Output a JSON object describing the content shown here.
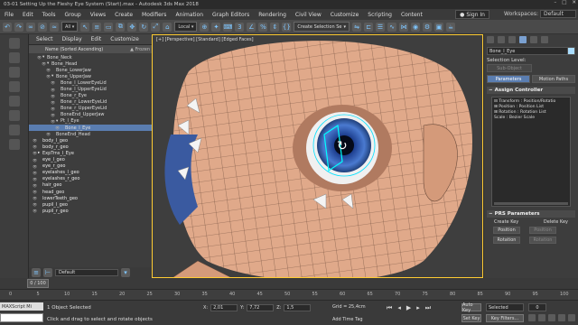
{
  "titlebar": {
    "title": "03-01 Setting Up the Fleshy Eye System (Start).max - Autodesk 3ds Max 2018",
    "min": "–",
    "max": "□",
    "close": "✕"
  },
  "menu": {
    "items": [
      "File",
      "Edit",
      "Tools",
      "Group",
      "Views",
      "Create",
      "Modifiers",
      "Animation",
      "Graph Editors",
      "Rendering",
      "Civil View",
      "Customize",
      "Scripting",
      "Content"
    ],
    "sign_in": "Sign In",
    "workspaces_label": "Workspaces:",
    "workspace_value": "Default"
  },
  "toolbar": {
    "ref_coord": "Local",
    "create_selection": "Create Selection Se"
  },
  "scene": {
    "tabs": [
      "Select",
      "Display",
      "Edit",
      "Customize"
    ],
    "header": "Name (Sorted Ascending)",
    "frozen_label": "▲ Frozen",
    "items": [
      {
        "label": "Bone_Neck",
        "indent": 1,
        "toggle": "▾"
      },
      {
        "label": "Bone_Head",
        "indent": 2,
        "toggle": "▾"
      },
      {
        "label": "Bone_LowerJaw",
        "indent": 3,
        "toggle": ""
      },
      {
        "label": "Bone_UpperJaw",
        "indent": 3,
        "toggle": "▾"
      },
      {
        "label": "Bone_l_LowerEyeLid",
        "indent": 4,
        "toggle": ""
      },
      {
        "label": "Bone_l_UpperEyeLid",
        "indent": 4,
        "toggle": ""
      },
      {
        "label": "Bone_r_Eye",
        "indent": 4,
        "toggle": ""
      },
      {
        "label": "Bone_r_LowerEyeLid",
        "indent": 4,
        "toggle": ""
      },
      {
        "label": "Bone_r_UpperEyeLid",
        "indent": 4,
        "toggle": ""
      },
      {
        "label": "BoneEnd_UpperJaw",
        "indent": 4,
        "toggle": ""
      },
      {
        "label": "Pt_l_Eye",
        "indent": 4,
        "toggle": "▾"
      },
      {
        "label": "Bone_l_Eye",
        "indent": 5,
        "toggle": "",
        "selected": true
      },
      {
        "label": "BoneEnd_Head",
        "indent": 3,
        "toggle": ""
      },
      {
        "label": "body_l_geo",
        "indent": 0,
        "toggle": ""
      },
      {
        "label": "body_r_geo",
        "indent": 0,
        "toggle": ""
      },
      {
        "label": "ExpTrns_l_Eye",
        "indent": 0,
        "toggle": "▸"
      },
      {
        "label": "eye_l_geo",
        "indent": 0,
        "toggle": ""
      },
      {
        "label": "eye_r_geo",
        "indent": 0,
        "toggle": ""
      },
      {
        "label": "eyelashes_l_geo",
        "indent": 0,
        "toggle": ""
      },
      {
        "label": "eyelashes_r_geo",
        "indent": 0,
        "toggle": ""
      },
      {
        "label": "hair_geo",
        "indent": 0,
        "toggle": ""
      },
      {
        "label": "head_geo",
        "indent": 0,
        "toggle": ""
      },
      {
        "label": "lowerTeeth_geo",
        "indent": 0,
        "toggle": ""
      },
      {
        "label": "pupil_l_geo",
        "indent": 0,
        "toggle": ""
      },
      {
        "label": "pupil_r_geo",
        "indent": 0,
        "toggle": ""
      }
    ],
    "layer_label": "Default"
  },
  "viewport": {
    "label": "[+] [Perspective] [Standard] [Edged Faces]"
  },
  "command": {
    "object_name": "Bone_l_Eye",
    "selection_level": "Selection Level:",
    "sub_object": "Sub-Object",
    "tab_parameters": "Parameters",
    "tab_motion_paths": "Motion Paths",
    "assign_controller": "Assign Controller",
    "controllers": [
      "⊟ Transform : Position/Rotatio",
      "   ⊞ Position : Position List",
      "   ⊞ Rotation : Rotation List",
      "   Scale : Bezier Scale"
    ],
    "prs": {
      "title": "PRS Parameters",
      "create_key": "Create Key",
      "delete_key": "Delete Key",
      "position": "Position",
      "rotation": "Rotation"
    }
  },
  "timeline": {
    "frame": "0 / 100",
    "ticks": [
      "0",
      "5",
      "10",
      "15",
      "20",
      "25",
      "30",
      "35",
      "40",
      "45",
      "50",
      "55",
      "60",
      "65",
      "70",
      "75",
      "80",
      "85",
      "90",
      "95",
      "100"
    ]
  },
  "status": {
    "maxscript": "MAXScript Mi",
    "selected": "1 Object Selected",
    "hint": "Click and drag to select and rotate objects",
    "x": "2,01",
    "y": "7,72",
    "z": "1,5",
    "grid": "Grid = 25,4cm",
    "add_time_tag": "Add Time Tag",
    "auto_key": "Auto Key",
    "set_key": "Set Key",
    "selected_filter": "Selected",
    "key_filters": "Key Filters...",
    "frame_field": "0"
  }
}
